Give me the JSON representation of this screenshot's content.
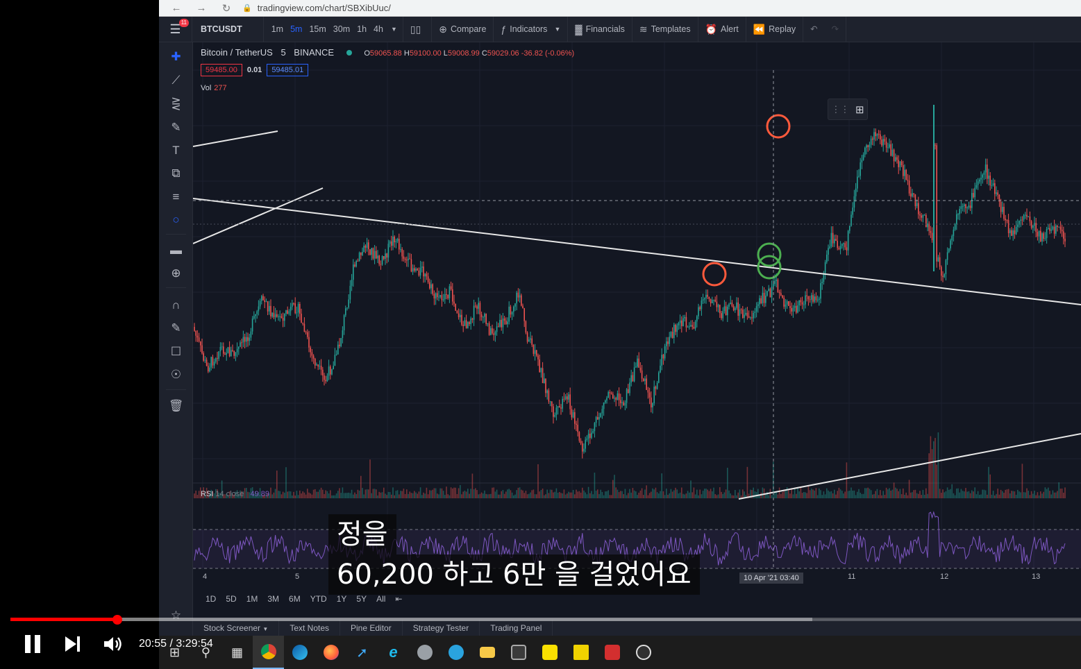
{
  "browser": {
    "back_icon": "arrow-left-icon",
    "forward_icon": "arrow-right-icon",
    "reload_icon": "reload-icon",
    "url": "tradingview.com/chart/SBXibUuc/"
  },
  "toolbar": {
    "notification_count": "11",
    "symbol": "BTCUSDT",
    "intervals": [
      "1m",
      "5m",
      "15m",
      "30m",
      "1h",
      "4h"
    ],
    "active_interval": "5m",
    "compare_label": "Compare",
    "indicators_label": "Indicators",
    "financials_label": "Financials",
    "templates_label": "Templates",
    "alert_label": "Alert",
    "replay_label": "Replay"
  },
  "legend": {
    "pair": "Bitcoin / TetherUS",
    "interval": "5",
    "exchange": "BINANCE",
    "open_k": "O",
    "open": "59065.88",
    "high_k": "H",
    "high": "59100.00",
    "low_k": "L",
    "low": "59008.99",
    "close_k": "C",
    "close": "59029.06",
    "change": "-36.82 (-0.06%)",
    "sell_price": "59485.00",
    "spread": "0.01",
    "buy_price": "59485.01",
    "vol_label": "Vol",
    "vol_value": "277",
    "rsi_label": "RSI",
    "rsi_params": "14 close",
    "rsi_value": "49.89"
  },
  "time_axis": {
    "labels": [
      "4",
      "5",
      "11",
      "12",
      "13"
    ],
    "crosshair_label": "10 Apr '21   03:40"
  },
  "range_buttons": [
    "1D",
    "5D",
    "1M",
    "3M",
    "6M",
    "YTD",
    "1Y",
    "5Y",
    "All"
  ],
  "bottom_tabs": [
    "Stock Screener",
    "Text Notes",
    "Pine Editor",
    "Strategy Tester",
    "Trading Panel"
  ],
  "player": {
    "time_display": "20:55 / 3:29:54",
    "progress_fraction": 0.0996
  },
  "subtitles": {
    "line1": "정을",
    "line2": "60,200 하고 6만 을 걸었어요"
  },
  "taskbar_icons": [
    "windows-start-icon",
    "search-icon",
    "task-view-icon",
    "chrome-icon",
    "edge-icon",
    "firefox-icon",
    "bird-app-icon",
    "ie-icon",
    "disk-app-icon",
    "telegram-icon",
    "file-explorer-icon",
    "calculator-icon",
    "kakaotalk-icon",
    "sticky-notes-icon",
    "red-app-icon",
    "obs-icon"
  ],
  "colors": {
    "chart_bg": "#131722",
    "toolbar_bg": "#1e222d",
    "up": "#26a69a",
    "down": "#ef5350",
    "accent": "#2962ff",
    "rsi": "#7e57c2",
    "marker_red": "#ff5a3c",
    "marker_green": "#4caf50",
    "progress": "#ff0000"
  },
  "chart_data": {
    "type": "candlestick",
    "symbol": "BTCUSDT",
    "interval": "5",
    "x_labels": [
      "4",
      "5",
      "10 Apr '21",
      "11",
      "12",
      "13"
    ],
    "annotations": [
      "red-circle-marker",
      "red-circle-marker",
      "green-circle-marker",
      "green-circle-marker",
      "trend-line",
      "trend-line",
      "trend-line",
      "trend-line"
    ],
    "indicators": [
      "Vol",
      "RSI 14 close"
    ]
  }
}
